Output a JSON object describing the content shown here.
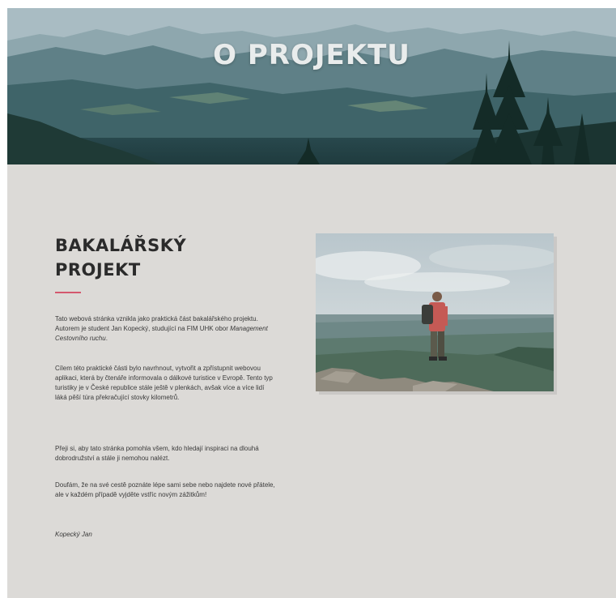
{
  "hero": {
    "title": "O PROJEKTU"
  },
  "section": {
    "heading_line1": "BAKALÁŘSKÝ",
    "heading_line2": "PROJEKT",
    "accent_color": "#d4586e",
    "p1_before": "Tato webová stránka vznikla jako praktická část bakalářského projektu. Autorem je student Jan Kopecký, studující na FIM UHK obor ",
    "p1_em": "Management Cestovního ruchu",
    "p1_after": ".",
    "p2": "Cílem této praktické části bylo navrhnout, vytvořit a zpřístupnit webovou aplikaci, která by čtenáře informovala o dálkové turistice v Evropě. Tento typ turistiky je v České republice stále ještě v plenkách, avšak více a více lidí láká pěší túra překračující stovky kilometrů.",
    "p3": "Přeji si, aby tato stránka pomohla všem, kdo hledají inspiraci na dlouhá dobrodružství a stále ji nemohou nalézt.",
    "p4": "Doufám, že na své cestě poznáte lépe sami sebe nebo najdete nové přátele, ale v každém případě vyjděte vstříc novým zážitkům!",
    "signature": "Kopecký Jan"
  },
  "images": {
    "hero_image": "mountain-forest-landscape",
    "side_image": "hiker-on-rock-overlooking-valley"
  }
}
